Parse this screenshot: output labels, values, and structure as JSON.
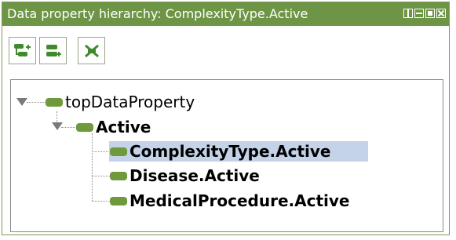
{
  "panel": {
    "title": "Data property hierarchy: ComplexityType.Active",
    "window_controls": [
      "view-icon",
      "minimize-icon",
      "maximize-icon",
      "close-icon"
    ]
  },
  "toolbar": {
    "buttons": [
      {
        "icon": "add-sub-property-icon"
      },
      {
        "icon": "add-sibling-property-icon"
      },
      {
        "icon": "delete-property-icon"
      }
    ]
  },
  "tree": {
    "root": {
      "label": "topDataProperty",
      "expanded": true
    },
    "active": {
      "label": "Active",
      "expanded": true
    },
    "children": [
      {
        "label": "ComplexityType.Active",
        "selected": true
      },
      {
        "label": "Disease.Active",
        "selected": false
      },
      {
        "label": "MedicalProcedure.Active",
        "selected": false
      }
    ]
  },
  "colors": {
    "titlebar": "#6e9545",
    "property_icon": "#6e9a3c",
    "selection": "#c4d3e8"
  }
}
